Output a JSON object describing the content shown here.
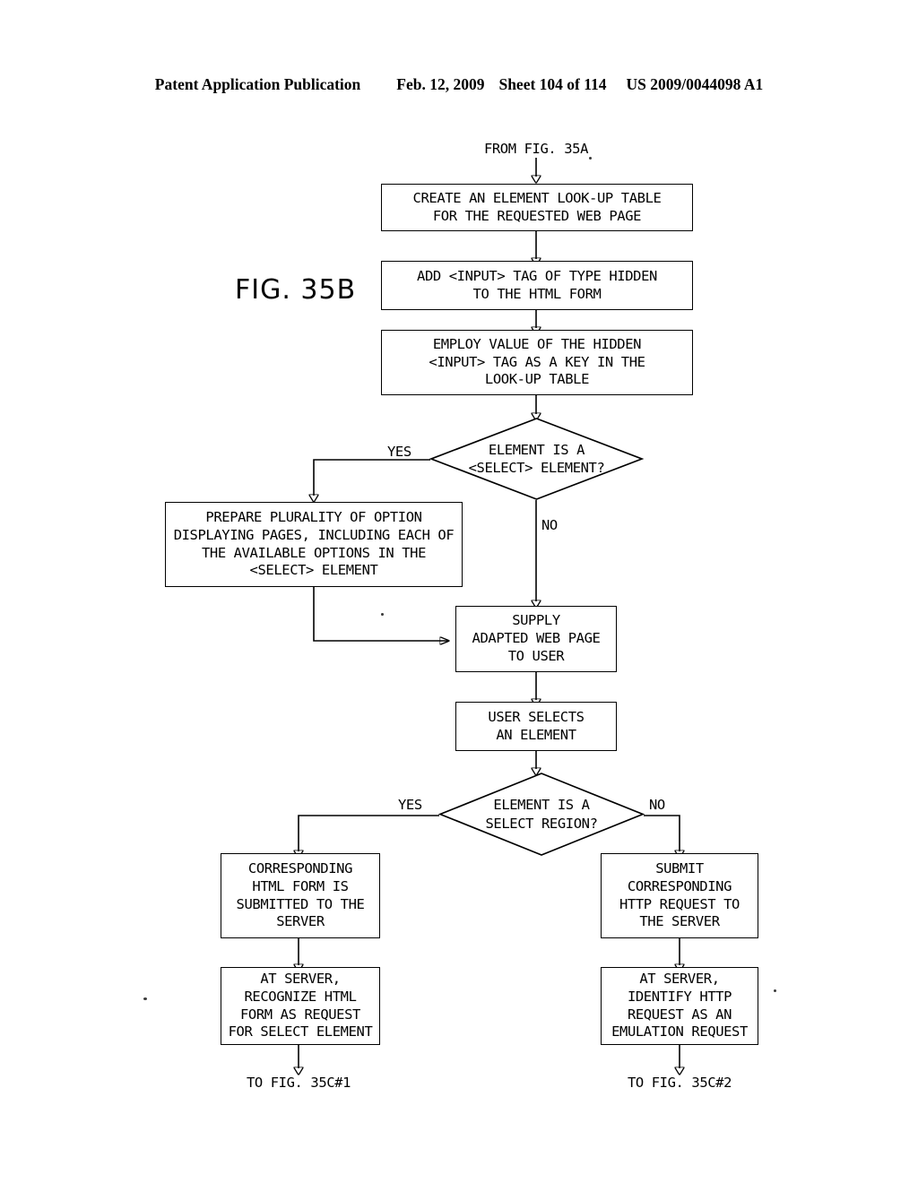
{
  "header": {
    "publication": "Patent Application Publication",
    "date": "Feb. 12, 2009",
    "sheet": "Sheet 104 of 114",
    "doc_number": "US 2009/0044098 A1"
  },
  "figure": {
    "label": "FIG.  35B"
  },
  "flow": {
    "entry_label": "FROM FIG.  35A",
    "nodes": {
      "create_lookup_table": "CREATE AN ELEMENT LOOK-UP TABLE\nFOR THE REQUESTED WEB PAGE",
      "add_input_tag": "ADD <INPUT> TAG OF TYPE HIDDEN\nTO THE HTML FORM",
      "employ_value_key": "EMPLOY VALUE OF THE HIDDEN\n<INPUT> TAG AS A KEY IN THE\nLOOK-UP TABLE",
      "decision_select_element": "ELEMENT IS A\n<SELECT> ELEMENT?",
      "prepare_option_pages": "PREPARE PLURALITY OF OPTION\nDISPLAYING PAGES, INCLUDING EACH OF\nTHE AVAILABLE OPTIONS IN THE\n<SELECT> ELEMENT",
      "supply_adapted_page": "SUPPLY\nADAPTED WEB PAGE\nTO USER",
      "user_selects_element": "USER SELECTS\nAN ELEMENT",
      "decision_select_region": "ELEMENT IS A\nSELECT REGION?",
      "html_form_submitted": "CORRESPONDING\nHTML FORM IS\nSUBMITTED TO THE\nSERVER",
      "recognize_html_form": "AT SERVER,\nRECOGNIZE HTML\nFORM AS REQUEST\nFOR SELECT ELEMENT",
      "submit_http_request": "SUBMIT\nCORRESPONDING\nHTTP REQUEST TO\nTHE SERVER",
      "identify_http_request": "AT SERVER,\nIDENTIFY HTTP\nREQUEST AS AN\nEMULATION REQUEST"
    },
    "branch_labels": {
      "yes_select_element": "YES",
      "no_select_element": "NO",
      "yes_select_region": "YES",
      "no_select_region": "NO"
    },
    "exits": {
      "to_fig_35c_1": "TO FIG.  35C#1",
      "to_fig_35c_2": "TO FIG.  35C#2"
    }
  },
  "colors": {
    "ink": "#000000",
    "paper": "#ffffff"
  }
}
